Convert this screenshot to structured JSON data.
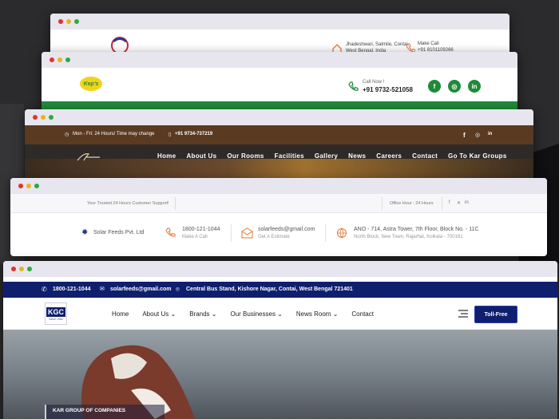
{
  "colors": {
    "background": "#2b2b2d",
    "green": "#1f8a3a",
    "brown": "#5b3a22",
    "navy": "#0f1f6e",
    "orange": "#e07a3a"
  },
  "w1": {
    "address": "Jhadeshwari, Satmile, Contai, West Bengal, India",
    "call_label": "Make Call",
    "call_number": "+91 8101109266"
  },
  "w2": {
    "logo_text": "Kep's",
    "call_label": "Call Now !",
    "call_number": "+91 9732-521058",
    "social": [
      "facebook-icon",
      "instagram-icon",
      "linkedin-icon"
    ]
  },
  "w3": {
    "hours": "Mon - Fri: 24 Hours/ Time may change",
    "phone": "+91 9734-737219",
    "nav": [
      "Home",
      "About Us",
      "Our Rooms",
      "Facilities",
      "Gallery",
      "News",
      "Careers",
      "Contact",
      "Go To Kar Groups"
    ]
  },
  "w4": {
    "support": "Your Trusted 24 Hours Customer Support!",
    "office_hours": "Office Hour : 24 Hours",
    "brand": "Solar Feeds Pvt. Ltd",
    "phone": "1800-121-1044",
    "phone_label": "Make A Call",
    "email": "solarfeeds@gmail.com",
    "email_label": "Get A Estimate",
    "address_line1": "ANO - 714, Astra Tower, 7th Floor, Block No. - 11C",
    "address_line2": "North Block, New Town, Rajarhat, Kolkata - 700161"
  },
  "w5": {
    "phone": "1800-121-1044",
    "email": "solarfeeds@gmail.com",
    "address": "Central Bus Stand, Kishore Nagar, Contai, West Bengal 721401",
    "logo_text": "KGC",
    "logo_since": "Since 1984",
    "nav": [
      "Home",
      "About Us",
      "Brands",
      "Our Businesses",
      "News Room",
      "Contact"
    ],
    "toll_free": "Toll-Free",
    "hero_label": "KAR GROUP OF COMPANIES"
  }
}
